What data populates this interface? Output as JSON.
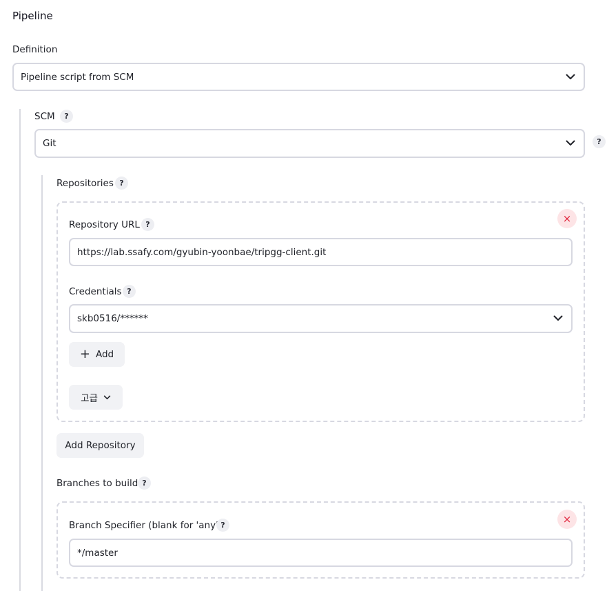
{
  "section": {
    "title": "Pipeline"
  },
  "definition": {
    "label": "Definition",
    "selected": "Pipeline script from SCM"
  },
  "scm": {
    "label": "SCM",
    "help": "?",
    "selected": "Git",
    "side_help": "?"
  },
  "repositories": {
    "label": "Repositories",
    "help": "?",
    "repository_url": {
      "label": "Repository URL",
      "help": "?",
      "value": "https://lab.ssafy.com/gyubin-yoonbae/tripgg-client.git"
    },
    "credentials": {
      "label": "Credentials",
      "help": "?",
      "selected": "skb0516/******"
    },
    "add_label": "Add",
    "add_icon": "+",
    "advanced_label": "고급",
    "delete_icon": "×",
    "add_repository_label": "Add Repository"
  },
  "branches": {
    "label": "Branches to build",
    "help": "?",
    "specifier": {
      "label": "Branch Specifier (blank for 'any')",
      "help": "?",
      "value": "*/master"
    },
    "delete_icon": "×"
  },
  "colors": {
    "border": "#d7d8e1",
    "help_bg": "#edeef2",
    "delete_bg": "#fde4e6",
    "delete_fg": "#e0223a",
    "button_bg": "#f1f2f5"
  }
}
